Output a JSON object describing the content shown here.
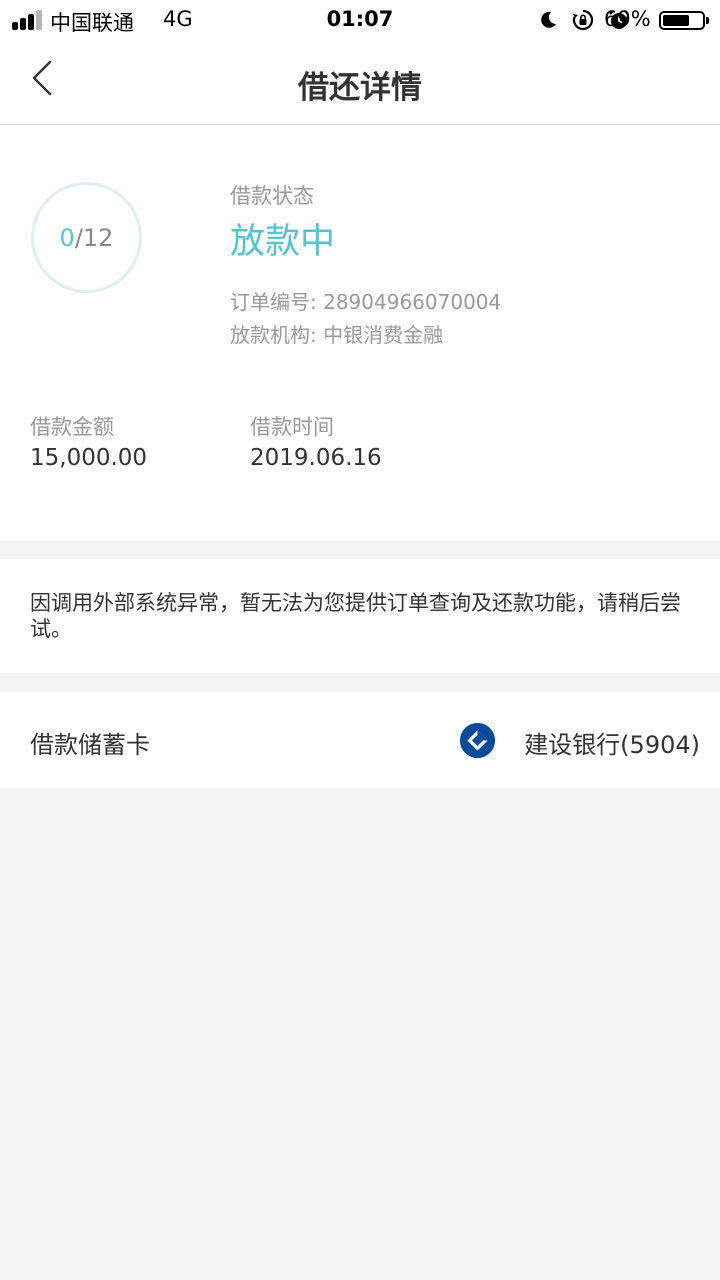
{
  "status_bar": {
    "carrier": "中国联通",
    "network": "4G",
    "time": "01:07",
    "battery_percent": "69%",
    "battery_level": 0.69,
    "icons": [
      "moon-icon",
      "rotation-lock-icon",
      "alarm-icon"
    ]
  },
  "nav": {
    "title": "借还详情",
    "back_icon": "chevron-left-icon"
  },
  "loan": {
    "progress_done": "0",
    "progress_total": "/12",
    "status_label": "借款状态",
    "status_value": "放款中",
    "order_number": "订单编号: 28904966070004",
    "lender": "放款机构: 中银消费金融",
    "amount_label": "借款金额",
    "amount_value": "15,000.00",
    "date_label": "借款时间",
    "date_value": "2019.06.16"
  },
  "notice": {
    "text": "因调用外部系统异常，暂无法为您提供订单查询及还款功能，请稍后尝试。"
  },
  "debit_card": {
    "label": "借款储蓄卡",
    "bank": "建设银行(5904)",
    "bank_icon": "ccb-bank-logo-icon"
  },
  "colors": {
    "accent": "#55c3cf",
    "muted": "#999999",
    "text": "#333333",
    "background": "#f3f3f3",
    "bank_blue": "#0a4a9a"
  }
}
